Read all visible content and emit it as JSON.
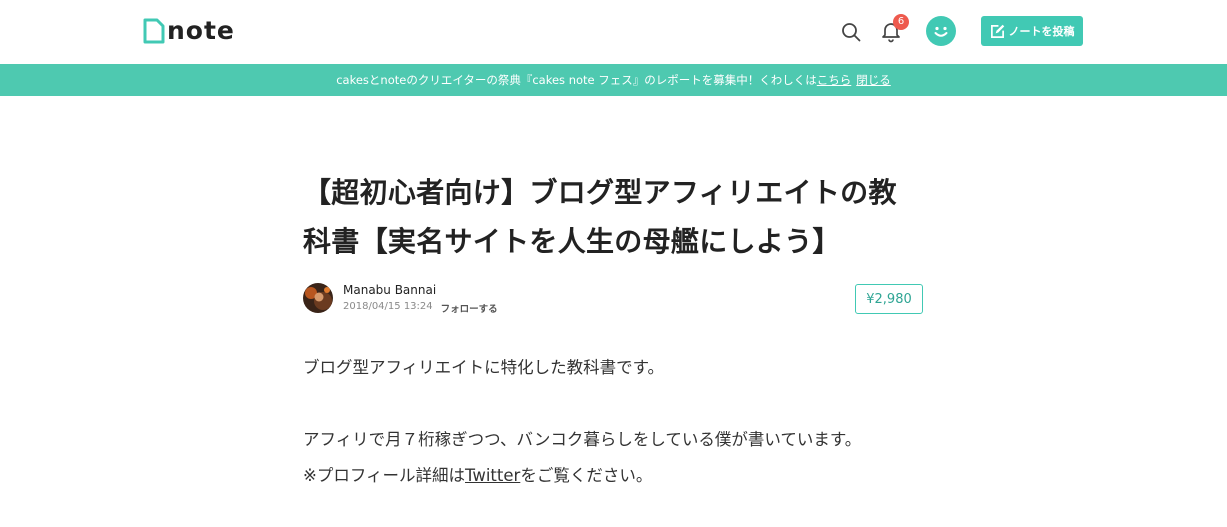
{
  "header": {
    "logo_text": "note",
    "notification_count": "6",
    "post_button_label": "ノートを投稿"
  },
  "banner": {
    "text": "cakesとnoteのクリエイターの祭典『cakes note フェス』のレポートを募集中！くわしくは",
    "link_label": "こちら",
    "close_label": "閉じる"
  },
  "article": {
    "title": "【超初心者向け】ブログ型アフィリエイトの教科書【実名サイトを人生の母艦にしよう】",
    "author_name": "Manabu Bannai",
    "date": "2018/04/15 13:24",
    "follow_label": "フォローする",
    "price": "¥2,980",
    "paragraph_1": "ブログ型アフィリエイトに特化した教科書です。",
    "paragraph_2": "アフィリで月７桁稼ぎつつ、バンコク暮らしをしている僕が書いています。",
    "paragraph_3_prefix": "※プロフィール詳細は",
    "paragraph_3_link": "Twitter",
    "paragraph_3_suffix": "をご覧ください。"
  },
  "colors": {
    "accent": "#41c9b4",
    "banner": "#4ec9b0",
    "badge": "#ee5a4e"
  }
}
